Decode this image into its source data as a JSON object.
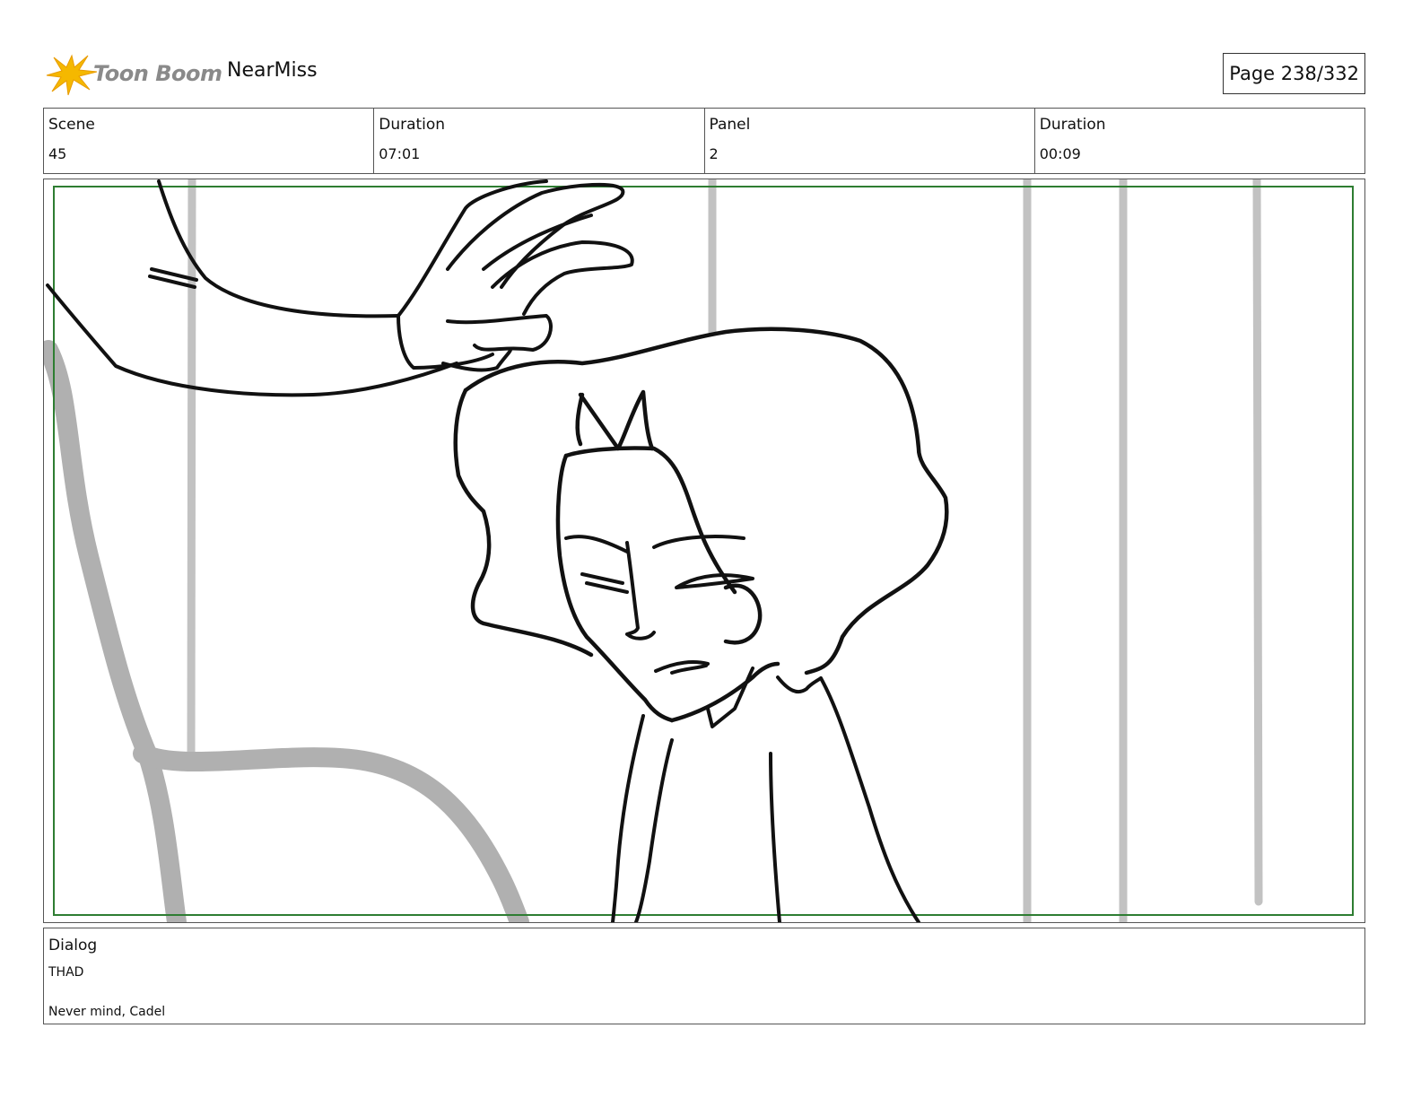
{
  "header": {
    "logo_text": "Toon Boom",
    "project_name": "NearMiss",
    "page_label": "Page 238/332"
  },
  "info": [
    {
      "label": "Scene",
      "value": "45"
    },
    {
      "label": "Duration",
      "value": "07:01"
    },
    {
      "label": "Panel",
      "value": "2"
    },
    {
      "label": "Duration",
      "value": "00:09"
    }
  ],
  "dialog": {
    "label": "Dialog",
    "character": "THAD",
    "line": "Never mind, Cadel"
  },
  "colors": {
    "safe_frame": "#2e7d32",
    "logo_star": "#f5b800",
    "sketch_gray": "#b0b0b0"
  }
}
